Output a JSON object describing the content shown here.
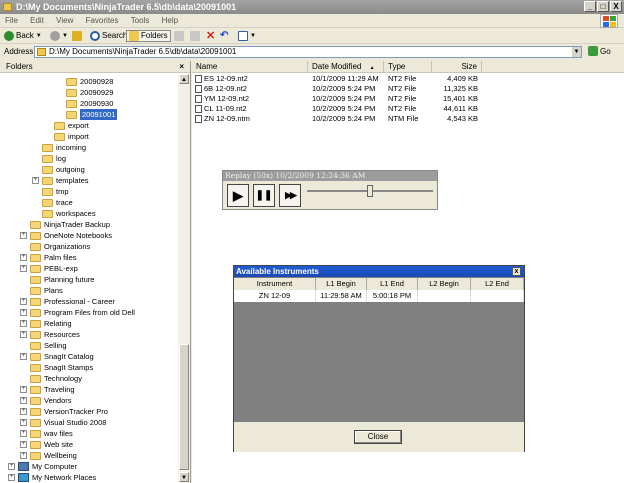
{
  "window": {
    "title": "D:\\My Documents\\NinjaTrader 6.5\\db\\data\\20091001",
    "minimize": "_",
    "maximize": "□",
    "close": "X"
  },
  "menu": [
    "File",
    "Edit",
    "View",
    "Favorites",
    "Tools",
    "Help"
  ],
  "toolbar": {
    "back": "Back",
    "search": "Search",
    "folders": "Folders"
  },
  "address": {
    "label": "Address",
    "value": "D:\\My Documents\\NinjaTrader 6.5\\db\\data\\20091001",
    "go": "Go"
  },
  "folders_pane": {
    "title": "Folders",
    "close": "×",
    "items": [
      {
        "label": "20090928"
      },
      {
        "label": "20090929"
      },
      {
        "label": "20090930"
      },
      {
        "label": "20091001"
      },
      {
        "label": "export"
      },
      {
        "label": "import"
      },
      {
        "label": "incoming"
      },
      {
        "label": "log"
      },
      {
        "label": "outgoing"
      },
      {
        "label": "templates"
      },
      {
        "label": "tmp"
      },
      {
        "label": "trace"
      },
      {
        "label": "workspaces"
      },
      {
        "label": "NinjaTrader Backup"
      },
      {
        "label": "OneNote Notebooks"
      },
      {
        "label": "Organizations"
      },
      {
        "label": "Palm files"
      },
      {
        "label": "PEBL-exp"
      },
      {
        "label": "Planning future"
      },
      {
        "label": "Plans"
      },
      {
        "label": "Professional - Career"
      },
      {
        "label": "Program Files from old Dell"
      },
      {
        "label": "Relating"
      },
      {
        "label": "Resources"
      },
      {
        "label": "Selling"
      },
      {
        "label": "SnagIt Catalog"
      },
      {
        "label": "SnagIt Stamps"
      },
      {
        "label": "Technology"
      },
      {
        "label": "Traveling"
      },
      {
        "label": "Vendors"
      },
      {
        "label": "VersionTracker Pro"
      },
      {
        "label": "Visual Studio 2008"
      },
      {
        "label": "wav files"
      },
      {
        "label": "Web site"
      },
      {
        "label": "Wellbeing"
      },
      {
        "label": "My Computer"
      },
      {
        "label": "My Network Places"
      }
    ]
  },
  "file_list": {
    "columns": [
      "Name",
      "Date Modified",
      "Type",
      "Size"
    ],
    "sort_indicator": "▲",
    "rows": [
      {
        "name": "ES 12-09.nt2",
        "date": "10/1/2009 11:29 AM",
        "type": "NT2 File",
        "size": "4,409 KB"
      },
      {
        "name": "6B 12-09.nt2",
        "date": "10/2/2009 5:24 PM",
        "type": "NT2 File",
        "size": "11,325 KB"
      },
      {
        "name": "YM 12-09.nt2",
        "date": "10/2/2009 5:24 PM",
        "type": "NT2 File",
        "size": "15,401 KB"
      },
      {
        "name": "CL 11-09.nt2",
        "date": "10/2/2009 5:24 PM",
        "type": "NT2 File",
        "size": "44,611 KB"
      },
      {
        "name": "ZN 12-09.ntm",
        "date": "10/2/2009 5:24 PM",
        "type": "NTM File",
        "size": "4,543 KB"
      }
    ]
  },
  "replay": {
    "title": "Replay (50x) 10/2/2009 12:24:36 AM",
    "play": "▶",
    "pause": "❚❚",
    "fast_forward": "▶▶",
    "slider_level": 0.5
  },
  "instruments": {
    "title": "Available Instruments",
    "close": "x",
    "columns": [
      "Instrument",
      "L1 Begin",
      "L1 End",
      "L2 Begin",
      "L2 End"
    ],
    "rows": [
      {
        "instrument": "ZN 12-09",
        "l1_begin": "11:29:58 AM",
        "l1_end": "5:00:18 PM",
        "l2_begin": "",
        "l2_end": ""
      }
    ],
    "close_button": "Close"
  }
}
